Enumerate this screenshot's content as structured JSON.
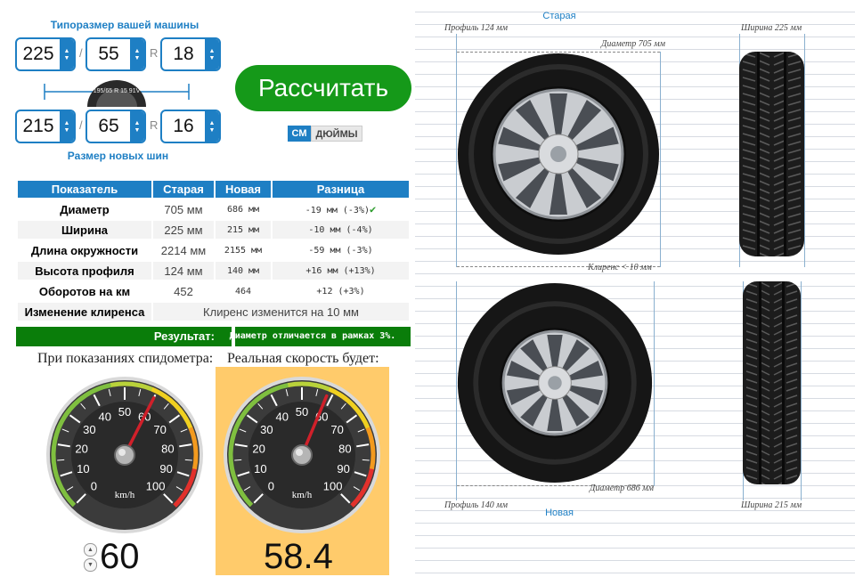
{
  "inputs": {
    "title_current": "Типоразмер вашей машины",
    "title_new": "Размер новых шин",
    "old": {
      "width": "225",
      "profile": "55",
      "rim": "18"
    },
    "new": {
      "width": "215",
      "profile": "65",
      "rim": "16"
    },
    "slash": "/",
    "r": "R"
  },
  "calc_button": "Рассчитать",
  "units": {
    "cm": "СМ",
    "inch": "ДЮЙМЫ",
    "active": "cm"
  },
  "table": {
    "headers": [
      "Показатель",
      "Старая",
      "Новая",
      "Разница"
    ],
    "rows": [
      {
        "label": "Диаметр",
        "old": "705 мм",
        "new": "686 мм",
        "diff": "-19 мм (-3%)",
        "ok": true
      },
      {
        "label": "Ширина",
        "old": "225 мм",
        "new": "215 мм",
        "diff": "-10 мм (-4%)"
      },
      {
        "label": "Длина окружности",
        "old": "2214 мм",
        "new": "2155 мм",
        "diff": "-59 мм (-3%)"
      },
      {
        "label": "Высота профиля",
        "old": "124 мм",
        "new": "140 мм",
        "diff": "+16 мм (+13%)"
      },
      {
        "label": "Оборотов на км",
        "old": "452",
        "new": "464",
        "diff": "+12 (+3%)"
      }
    ],
    "clearance_label": "Изменение клиренса",
    "clearance_text": "Клиренс изменится на 10 мм"
  },
  "result": {
    "label": "Результат:",
    "text": "Диаметр отличается в рамках 3%."
  },
  "speedo": {
    "caption_left": "При показаниях спидометра:",
    "caption_right": "Реальная скорость будет:",
    "unit": "km/h",
    "ticks": [
      "0",
      "10",
      "20",
      "30",
      "40",
      "50",
      "60",
      "70",
      "80",
      "90",
      "100"
    ],
    "shown_speed": 60,
    "real_speed": 58.4,
    "shown_speed_text": "60",
    "real_speed_text": "58.4"
  },
  "tire_image": {
    "badge": "195/65 R 15 91V"
  },
  "diagram": {
    "old_title": "Старая",
    "new_title": "Новая",
    "old_profile": "Профиль 124 мм",
    "old_width": "Ширина 225 мм",
    "old_diameter": "Диаметр 705 мм",
    "clearance": "Клиренс < 10 мм",
    "new_diameter": "Диаметр 686 мм",
    "new_profile": "Профиль 140 мм",
    "new_width": "Ширина 215 мм"
  },
  "colors": {
    "accent": "#1e7fc4",
    "button": "#159919",
    "result": "#0a7d0a",
    "highlight": "#ffcb6b",
    "needle": "#d0202a"
  }
}
